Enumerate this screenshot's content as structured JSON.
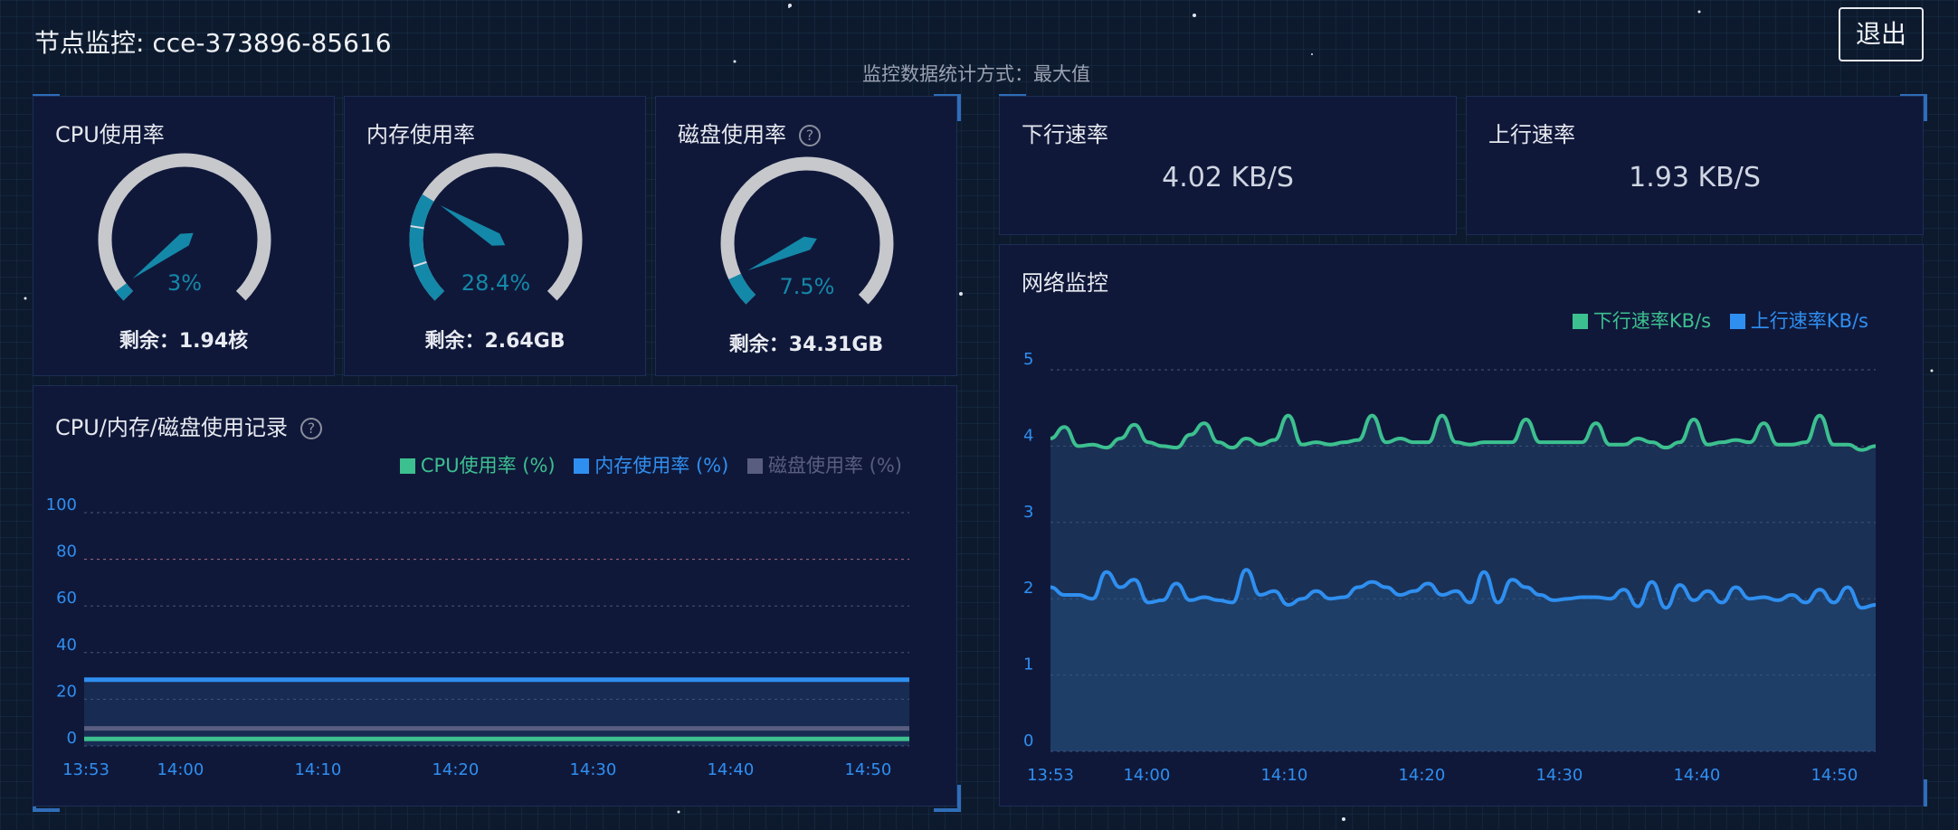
{
  "header": {
    "title": "节点监控: cce-373896-85616",
    "subtitle": "监控数据统计方式：最大值",
    "exit_label": "退出"
  },
  "gauges": [
    {
      "title": "CPU使用率",
      "value_text": "3%",
      "percent": 3,
      "remaining": "剩余：1.94核",
      "help": false
    },
    {
      "title": "内存使用率",
      "value_text": "28.4%",
      "percent": 28.4,
      "remaining": "剩余：2.64GB",
      "help": false
    },
    {
      "title": "磁盘使用率",
      "value_text": "7.5%",
      "percent": 7.5,
      "remaining": "剩余：34.31GB",
      "help": true
    }
  ],
  "help_glyph": "?",
  "speeds": {
    "down": {
      "title": "下行速率",
      "value": "4.02 KB/S"
    },
    "up": {
      "title": "上行速率",
      "value": "1.93 KB/S"
    }
  },
  "usage_chart_title": "CPU/内存/磁盘使用记录",
  "network_chart_title": "网络监控",
  "colors": {
    "cpu": "#3cc08f",
    "mem": "#2f8ff0",
    "disk": "#595e80",
    "gauge_track": "#c6c8cc",
    "gauge_fill": "#1488a8",
    "accent": "#2f6db8"
  },
  "chart_data": [
    {
      "type": "line",
      "title": "CPU/内存/磁盘使用记录",
      "x": [
        "13:53",
        "14:00",
        "14:10",
        "14:20",
        "14:30",
        "14:40",
        "14:50"
      ],
      "x_minutes": [
        0,
        7,
        17,
        27,
        37,
        47,
        57
      ],
      "x_range": [
        0,
        60
      ],
      "ylim": [
        0,
        100
      ],
      "yticks": [
        0,
        20,
        40,
        60,
        80,
        100
      ],
      "grid": true,
      "legend_position": "top-right",
      "series": [
        {
          "name": "CPU使用率 (%)",
          "values": [
            3,
            3,
            3,
            3,
            3,
            3,
            3
          ]
        },
        {
          "name": "内存使用率 (%)",
          "values": [
            28.4,
            28.4,
            28.4,
            28.4,
            28.4,
            28.4,
            28.4
          ]
        },
        {
          "name": "磁盘使用率 (%)",
          "values": [
            7.5,
            7.5,
            7.5,
            7.5,
            7.5,
            7.5,
            7.5
          ]
        }
      ]
    },
    {
      "type": "area",
      "title": "网络监控",
      "x": [
        "13:53",
        "14:00",
        "14:10",
        "14:20",
        "14:30",
        "14:40",
        "14:50"
      ],
      "x_range": [
        0,
        60
      ],
      "ylim": [
        0,
        5
      ],
      "yticks": [
        0,
        1,
        2,
        3,
        4,
        5
      ],
      "grid": true,
      "legend_position": "top-right",
      "series": [
        {
          "name": "下行速率KB/s",
          "values": [
            4.1,
            4.25,
            4.0,
            4.02,
            3.98,
            4.1,
            4.28,
            4.05,
            4.0,
            3.98,
            4.15,
            4.3,
            4.05,
            3.98,
            4.1,
            4.02,
            4.08,
            4.4,
            4.02,
            4.05,
            4.02,
            4.05,
            4.08,
            4.4,
            4.05,
            4.1,
            4.05,
            4.05,
            4.4,
            4.05,
            4.02,
            4.05,
            4.05,
            4.05,
            4.35,
            4.05,
            4.05,
            4.05,
            4.05,
            4.3,
            4.02,
            4.02,
            4.1,
            4.05,
            3.98,
            4.05,
            4.35,
            4.02,
            4.05,
            4.08,
            4.05,
            4.3,
            4.02,
            4.02,
            4.05,
            4.4,
            4.02,
            4.02,
            3.95,
            4.0
          ]
        },
        {
          "name": "上行速率KB/s",
          "values": [
            2.15,
            2.05,
            2.05,
            2.0,
            2.35,
            2.15,
            2.25,
            1.95,
            1.98,
            2.2,
            1.98,
            2.02,
            1.98,
            1.95,
            2.38,
            2.05,
            2.1,
            1.92,
            2.0,
            2.1,
            2.0,
            2.02,
            2.15,
            2.22,
            2.15,
            2.05,
            2.1,
            2.2,
            2.05,
            2.1,
            1.95,
            2.35,
            1.95,
            2.25,
            2.15,
            2.05,
            1.98,
            2.0,
            2.02,
            2.02,
            2.0,
            2.12,
            1.9,
            2.22,
            1.88,
            2.18,
            1.98,
            2.1,
            1.95,
            2.15,
            2.0,
            2.02,
            1.98,
            2.05,
            1.95,
            2.12,
            1.95,
            2.15,
            1.88,
            1.92
          ]
        }
      ]
    }
  ]
}
